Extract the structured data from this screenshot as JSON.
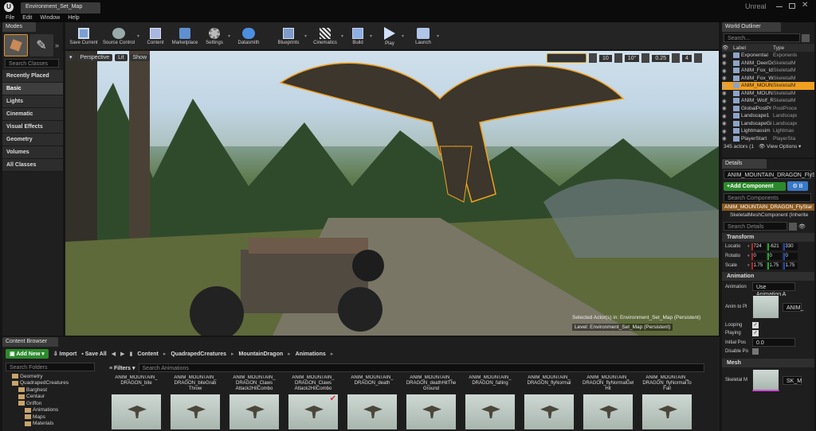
{
  "app": {
    "tab_title": "Environment_Set_Map",
    "brand": "Unreal"
  },
  "menu": [
    "File",
    "Edit",
    "Window",
    "Help"
  ],
  "modes": {
    "title": "Modes",
    "search_placeholder": "Search Classes",
    "categories": [
      "Recently Placed",
      "Basic",
      "Lights",
      "Cinematic",
      "Visual Effects",
      "Geometry",
      "Volumes",
      "All Classes"
    ],
    "selected": "Basic"
  },
  "toolbar": [
    "Save Current",
    "Source Control",
    "Content",
    "Marketplace",
    "Settings",
    "Datasmith",
    "Blueprints",
    "Cinematics",
    "Build",
    "Play",
    "Launch"
  ],
  "viewport": {
    "perspective": "Perspective",
    "lit": "Lit",
    "show": "Show",
    "snap_grid": "10",
    "snap_angle": "10°",
    "snap_scale": "0.25",
    "cam_speed": "4",
    "selected_actor": "Selected Actor(s) in:  Environment_Set_Map (Persistent)",
    "level": "Level:  Environment_Set_Map (Persistent)"
  },
  "outliner": {
    "title": "World Outliner",
    "search_placeholder": "Search...",
    "col_label": "Label",
    "col_type": "Type",
    "rows": [
      {
        "label": "Exponential",
        "type": "Exponentia"
      },
      {
        "label": "ANIM_DeerDo",
        "type": "SkeletalM"
      },
      {
        "label": "ANIM_Fox_Id",
        "type": "SkeletalM"
      },
      {
        "label": "ANIM_Fox_W",
        "type": "SkeletalM"
      },
      {
        "label": "ANIM_MOUN",
        "type": "SkeletalM"
      },
      {
        "label": "ANIM_MOUN",
        "type": "SkeletalM"
      },
      {
        "label": "ANIM_Wolf_R",
        "type": "SkeletalM"
      },
      {
        "label": "GlobalPostPr",
        "type": "PostProce"
      },
      {
        "label": "Landscape1",
        "type": "Landscape"
      },
      {
        "label": "LandscapeGi",
        "type": "Landscape"
      },
      {
        "label": "Lightmassim",
        "type": "Lightmas"
      },
      {
        "label": "PlayerStart",
        "type": "PlayerSta"
      }
    ],
    "selected_index": 4,
    "count": "345 actors (1",
    "view_options": "View Options"
  },
  "details": {
    "title": "Details",
    "name": "ANIM_MOUNTAIN_DRAGON_FlySta",
    "add_component": "+Add Component",
    "bp_label": "B",
    "search_components": "Search Components",
    "comp_root": "ANIM_MOUNTAIN_DRAGON_FlyStar",
    "comp_child": "SkeletalMeshComponent (Inherite",
    "search_details": "Search Details",
    "transform": {
      "title": "Transform",
      "location_label": "Locatio",
      "location": [
        "724",
        "-621",
        "330"
      ],
      "rotation_label": "Rotatio",
      "rotation": [
        "0",
        "0",
        "0"
      ],
      "scale_label": "Scale",
      "scale": [
        "1.75",
        "1.75",
        "1.75"
      ]
    },
    "animation": {
      "title": "Animation",
      "mode_label": "Animation",
      "mode_value": "Use Animation A",
      "anim_label": "Anim to Pl",
      "anim_value": "ANIM_",
      "looping": "Looping",
      "playing": "Playing",
      "init_pos": "Initial Pos",
      "init_val": "0.0",
      "disable_pp": "Disable Po"
    },
    "mesh": {
      "title": "Mesh",
      "skeletal_label": "Skeletal M",
      "skeletal_value": "SK_M"
    }
  },
  "content": {
    "tab": "Content Browser",
    "add_new": "Add New",
    "import": "Import",
    "save_all": "Save All",
    "path": [
      "Content",
      "QuadrapedCreatures",
      "MountainDragon",
      "Animations"
    ],
    "search_folders": "Search Folders",
    "filters": "Filters",
    "search_assets": "Search Animations",
    "folders": [
      {
        "name": "Geometry",
        "depth": 1
      },
      {
        "name": "QuadrapedCreatures",
        "depth": 1
      },
      {
        "name": "Barghest",
        "depth": 2
      },
      {
        "name": "Centaur",
        "depth": 2
      },
      {
        "name": "Griffon",
        "depth": 2
      },
      {
        "name": "Animations",
        "depth": 3
      },
      {
        "name": "Maps",
        "depth": 3
      },
      {
        "name": "Materials",
        "depth": 3
      }
    ],
    "assets": [
      "ANIM_MOUNTAIN_\nDRAGON_bite",
      "ANIM_MOUNTAIN_\nDRAGON_biteGrab\nThrow",
      "ANIM_MOUNTAIN_\nDRAGON_Claws\nAttack2HitCombo",
      "ANIM_MOUNTAIN_\nDRAGON_Claws\nAttack2HitCombo",
      "ANIM_MOUNTAIN_\nDRAGON_death",
      "ANIM_MOUNTAIN_\nDRAGON_deathHitThe\nGround",
      "ANIM_MOUNTAIN_\nDRAGON_falling",
      "ANIM_MOUNTAIN_\nDRAGON_flyNormal",
      "ANIM_MOUNTAIN_\nDRAGON_flyNormalGet\nHit",
      "ANIM_MOUNTAIN_\nDRAGON_flyNormalTo\nFall"
    ]
  }
}
